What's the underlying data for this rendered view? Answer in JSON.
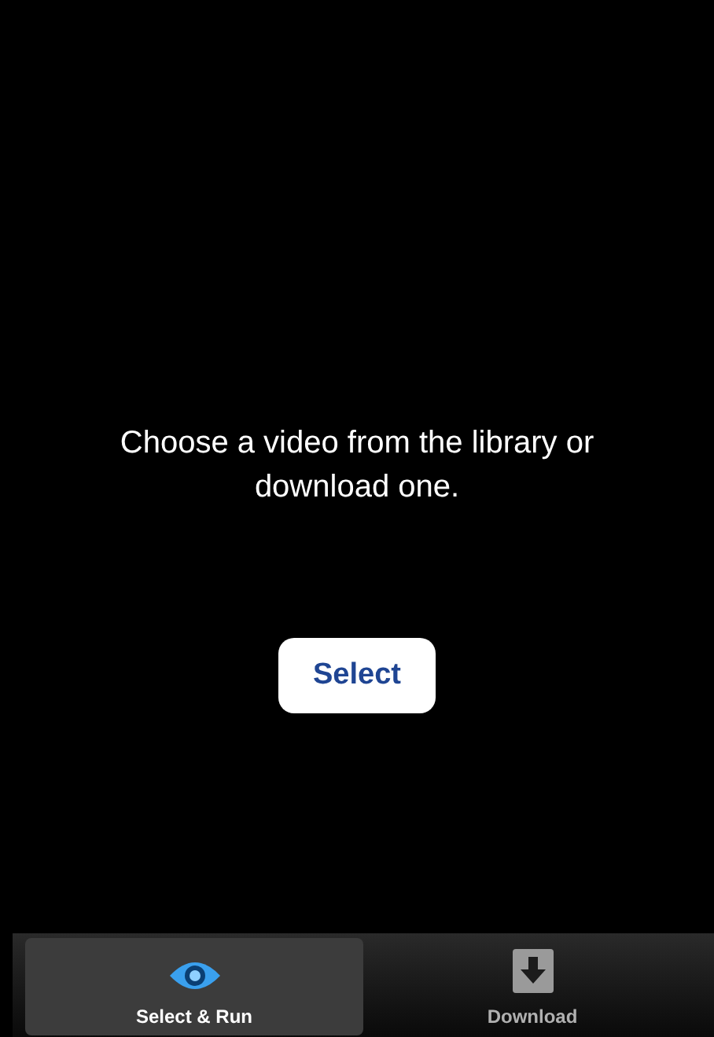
{
  "message": "Choose a video from the library or download one.",
  "select_button": {
    "label": "Select"
  },
  "tabs": [
    {
      "label": "Select & Run",
      "kind": "eye",
      "selected": true
    },
    {
      "label": "Download",
      "kind": "download",
      "selected": false
    }
  ]
}
